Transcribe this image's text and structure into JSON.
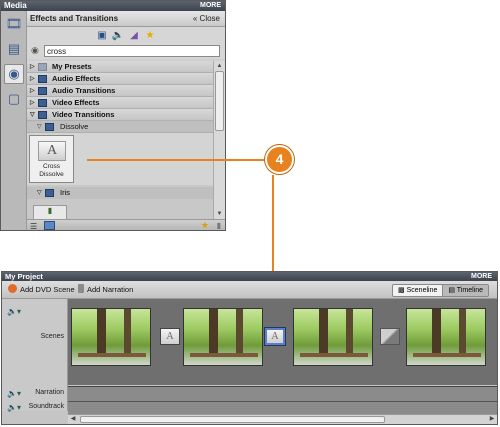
{
  "media": {
    "title": "Media",
    "more": "MORE",
    "panel_title": "Effects and Transitions",
    "close_label": "Close",
    "search_value": "cross",
    "tree": [
      {
        "label": "My Presets"
      },
      {
        "label": "Audio Effects"
      },
      {
        "label": "Audio Transitions"
      },
      {
        "label": "Video Effects"
      },
      {
        "label": "Video Transitions"
      }
    ],
    "subgroup": "Dissolve",
    "thumb_glyph": "A",
    "thumb_label": "Cross Dissolve",
    "subgroup2": "Iris"
  },
  "callout": {
    "number": "4"
  },
  "project": {
    "title": "My Project",
    "more": "MORE",
    "add_dvd_scene": "Add DVD Scene",
    "add_narration": "Add Narration",
    "sceneline": "Sceneline",
    "timeline": "Timeline",
    "tracks": {
      "scenes": "Scenes",
      "narration": "Narration",
      "soundtrack": "Soundtrack"
    },
    "transition_glyph": "A"
  },
  "colors": {
    "accent": "#e8821e",
    "selection": "#5a7fc6"
  },
  "icons": [
    "organizer-icon",
    "project-icon",
    "edit-icon",
    "disc-menu-icon",
    "video-filter-icon",
    "audio-filter-icon",
    "transition-filter-icon",
    "favorite-star-icon",
    "search-icon",
    "speaker-icon"
  ]
}
